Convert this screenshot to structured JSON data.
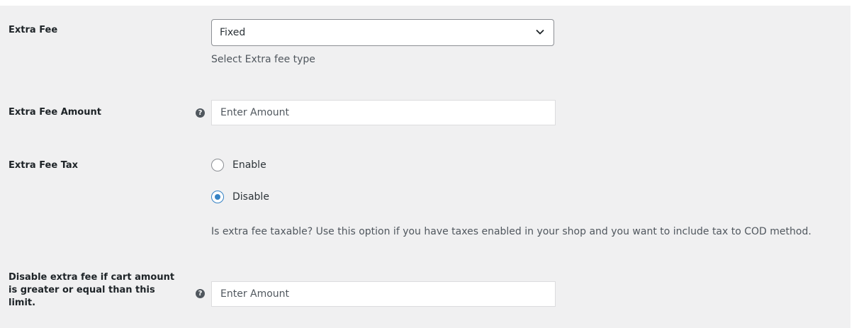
{
  "fields": {
    "extra_fee": {
      "label": "Extra Fee",
      "selected": "Fixed",
      "description": "Select Extra fee type",
      "icon": "chevron-down-icon"
    },
    "extra_fee_amount": {
      "label": "Extra Fee Amount",
      "help_icon": "?",
      "placeholder": "Enter Amount",
      "value": ""
    },
    "extra_fee_tax": {
      "label": "Extra Fee Tax",
      "options": [
        {
          "label": "Enable",
          "checked": false
        },
        {
          "label": "Disable",
          "checked": true
        }
      ],
      "description": "Is extra fee taxable? Use this option if you have taxes enabled in your shop and you want to include tax to COD method."
    },
    "disable_limit": {
      "label_lines": [
        "Disable extra fee if cart amount",
        "is greater or equal than this",
        "limit."
      ],
      "help_icon": "?",
      "placeholder": "Enter Amount",
      "value": ""
    }
  },
  "colors": {
    "panel_background": "#f0f0f1",
    "radio_accent": "#3582c4",
    "help_icon": "#50575e"
  }
}
